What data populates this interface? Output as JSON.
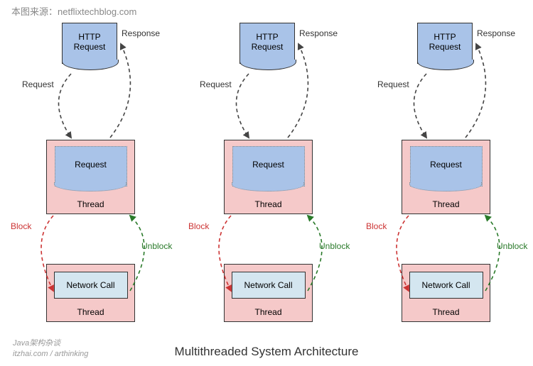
{
  "source_label": "本图来源：netflixtechblog.com",
  "title": "Multithreaded System Architecture",
  "watermark_line1": "Java架构杂谈",
  "watermark_line2": "itzhai.com / arthinking",
  "node_labels": {
    "http": "HTTP\nRequest",
    "request_inner": "Request",
    "network_call": "Network Call",
    "thread": "Thread"
  },
  "arrow_labels": {
    "request": "Request",
    "response": "Response",
    "block": "Block",
    "unblock": "Unblock"
  },
  "column_count": 3
}
